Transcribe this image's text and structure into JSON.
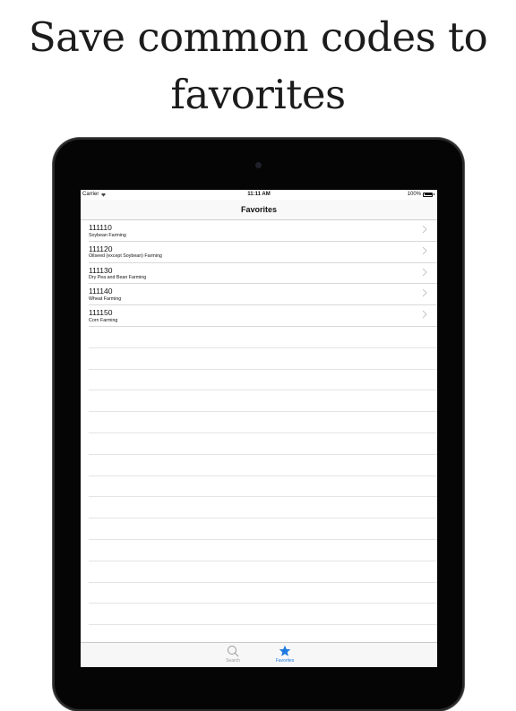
{
  "headline": {
    "line1": "Save common codes to",
    "line2": "favorites"
  },
  "status_bar": {
    "carrier": "Carrier",
    "time": "11:11 AM",
    "battery": "100%"
  },
  "nav": {
    "title": "Favorites"
  },
  "favorites": [
    {
      "code": "111110",
      "description": "Soybean Farming"
    },
    {
      "code": "111120",
      "description": "Oilseed (except Soybean) Farming"
    },
    {
      "code": "111130",
      "description": "Dry Pea and Bean Farming"
    },
    {
      "code": "111140",
      "description": "Wheat Farming"
    },
    {
      "code": "111150",
      "description": "Corn Farming"
    }
  ],
  "tab_bar": {
    "tabs": [
      {
        "label": "Search",
        "icon": "search-icon",
        "selected": false
      },
      {
        "label": "Favorites",
        "icon": "star-icon",
        "selected": true
      }
    ]
  },
  "colors": {
    "accent": "#1f7ae0",
    "inactive_tab": "#9a9a9a",
    "device_bezel": "#050505"
  }
}
